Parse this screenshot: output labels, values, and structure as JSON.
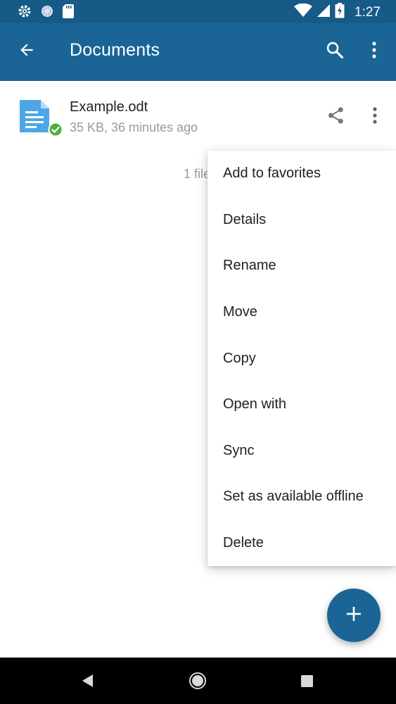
{
  "status_bar": {
    "time": "1:27",
    "icons": [
      "settings-icon",
      "sync-circle-icon",
      "sd-card-icon",
      "wifi-icon",
      "signal-icon",
      "battery-charging-icon"
    ]
  },
  "app_bar": {
    "title": "Documents",
    "icons": [
      "back-arrow-icon",
      "search-icon",
      "more-vert-icon"
    ],
    "color": "#1a6596"
  },
  "files": [
    {
      "name": "Example.odt",
      "meta": "35 KB, 36 minutes ago",
      "icons": [
        "document-icon",
        "synced-check-icon",
        "share-icon",
        "more-vert-icon"
      ]
    }
  ],
  "file_count_text": "1 file",
  "context_menu": {
    "items": [
      "Add to favorites",
      "Details",
      "Rename",
      "Move",
      "Copy",
      "Open with",
      "Sync",
      "Set as available offline",
      "Delete"
    ]
  },
  "fab": {
    "icon": "plus-icon",
    "color": "#1a6596"
  },
  "nav_bar": {
    "icons": [
      "nav-back-icon",
      "nav-home-icon",
      "nav-recents-icon"
    ]
  }
}
